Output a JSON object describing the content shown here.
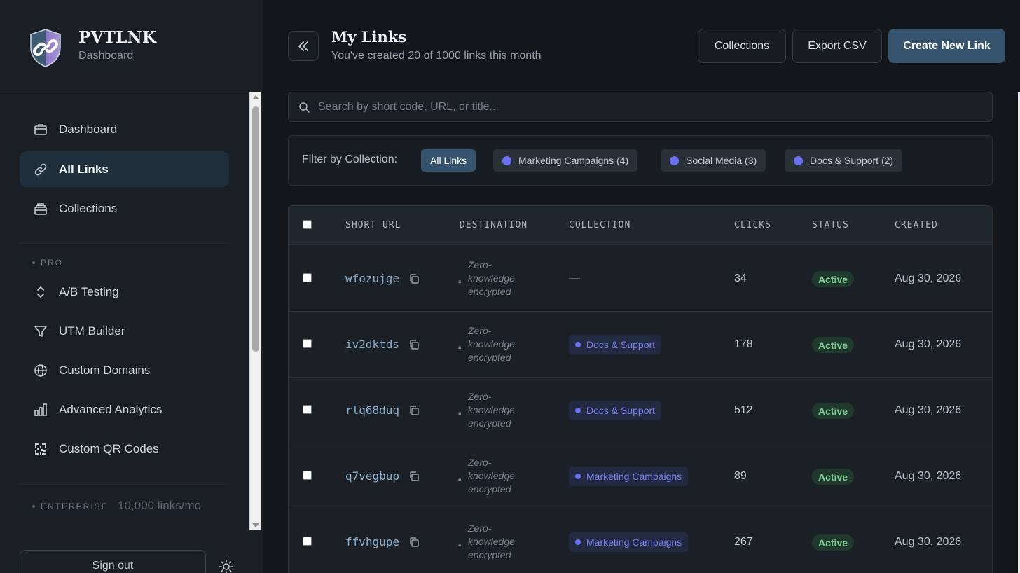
{
  "brand": {
    "title": "PVTLNK",
    "subtitle": "Dashboard"
  },
  "sidebar": {
    "items": [
      {
        "label": "Dashboard",
        "icon": "briefcase-icon"
      },
      {
        "label": "All Links",
        "icon": "link-icon",
        "active": true
      },
      {
        "label": "Collections",
        "icon": "folder-stack-icon"
      }
    ],
    "pro_label": "PRO",
    "pro_items": [
      {
        "label": "A/B Testing",
        "icon": "updown-chevron-icon"
      },
      {
        "label": "UTM Builder",
        "icon": "funnel-icon"
      },
      {
        "label": "Custom Domains",
        "icon": "globe-icon"
      },
      {
        "label": "Advanced Analytics",
        "icon": "bar-chart-icon"
      },
      {
        "label": "Custom QR Codes",
        "icon": "qr-code-icon"
      }
    ],
    "enterprise_label": "ENTERPRISE",
    "enterprise_note": "10,000 links/mo",
    "sign_out": "Sign out"
  },
  "header": {
    "title": "My Links",
    "subtitle": "You've created 20 of 1000 links this month",
    "collections_btn": "Collections",
    "export_btn": "Export CSV",
    "create_btn": "Create New Link"
  },
  "search": {
    "placeholder": "Search by short code, URL, or title..."
  },
  "filter": {
    "label": "Filter by Collection:",
    "chips": [
      "All Links",
      "Marketing Campaigns (4)",
      "Social Media (3)",
      "Docs & Support (2)"
    ]
  },
  "table": {
    "headers": [
      "SHORT URL",
      "DESTINATION",
      "COLLECTION",
      "CLICKS",
      "STATUS",
      "CREATED"
    ],
    "dest_lines": [
      "Zero-",
      "knowledge",
      "encrypted"
    ],
    "rows": [
      {
        "short": "wfozujge",
        "collection": "—",
        "clicks": "34",
        "status": "Active",
        "created": "Aug 30, 2026"
      },
      {
        "short": "iv2dktds",
        "collection": "Docs & Support",
        "clicks": "178",
        "status": "Active",
        "created": "Aug 30, 2026"
      },
      {
        "short": "rlq68duq",
        "collection": "Docs & Support",
        "clicks": "512",
        "status": "Active",
        "created": "Aug 30, 2026"
      },
      {
        "short": "q7vegbup",
        "collection": "Marketing Campaigns",
        "clicks": "89",
        "status": "Active",
        "created": "Aug 30, 2026"
      },
      {
        "short": "ffvhgupe",
        "collection": "Marketing Campaigns",
        "clicks": "267",
        "status": "Active",
        "created": "Aug 30, 2026"
      }
    ]
  },
  "colors": {
    "accent": "#36536d",
    "collection_dot": "#6b6ff0",
    "status_green": "#7fcf98"
  }
}
